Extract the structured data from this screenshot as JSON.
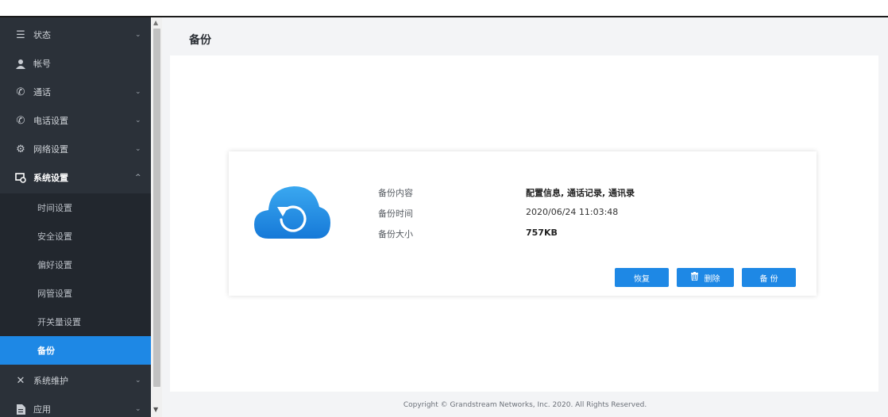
{
  "sidebar": {
    "items": [
      {
        "label": "状态",
        "icon": "list-icon",
        "chevron": "⌄"
      },
      {
        "label": "帐号",
        "icon": "user-icon",
        "chevron": ""
      },
      {
        "label": "通话",
        "icon": "call-icon",
        "chevron": "⌄"
      },
      {
        "label": "电话设置",
        "icon": "phone-icon",
        "chevron": "⌄"
      },
      {
        "label": "网络设置",
        "icon": "network-icon",
        "chevron": "⌄"
      },
      {
        "label": "系统设置",
        "icon": "system-settings-icon",
        "chevron": "^"
      }
    ],
    "subitems": [
      {
        "label": "时间设置"
      },
      {
        "label": "安全设置"
      },
      {
        "label": "偏好设置"
      },
      {
        "label": "网管设置"
      },
      {
        "label": "开关量设置"
      },
      {
        "label": "备份",
        "active": true
      }
    ],
    "bottom_items": [
      {
        "label": "系统维护",
        "icon": "tools-icon",
        "chevron": "⌄"
      },
      {
        "label": "应用",
        "icon": "document-icon",
        "chevron": "⌄"
      }
    ]
  },
  "page": {
    "title": "备份"
  },
  "backup": {
    "content_label": "备份内容",
    "content_value": "配置信息, 通话记录, 通讯录",
    "time_label": "备份时间",
    "time_value": "2020/06/24 11:03:48",
    "size_label": "备份大小",
    "size_value": "757KB"
  },
  "buttons": {
    "restore": "恢复",
    "delete": "删除",
    "backup": "备 份"
  },
  "footer": "Copyright © Grandstream Networks, Inc. 2020. All Rights Reserved.",
  "colors": {
    "accent": "#1e88e5",
    "sidebar": "#2b3139",
    "submenu": "#22272e",
    "main_bg": "#f3f4f6"
  }
}
